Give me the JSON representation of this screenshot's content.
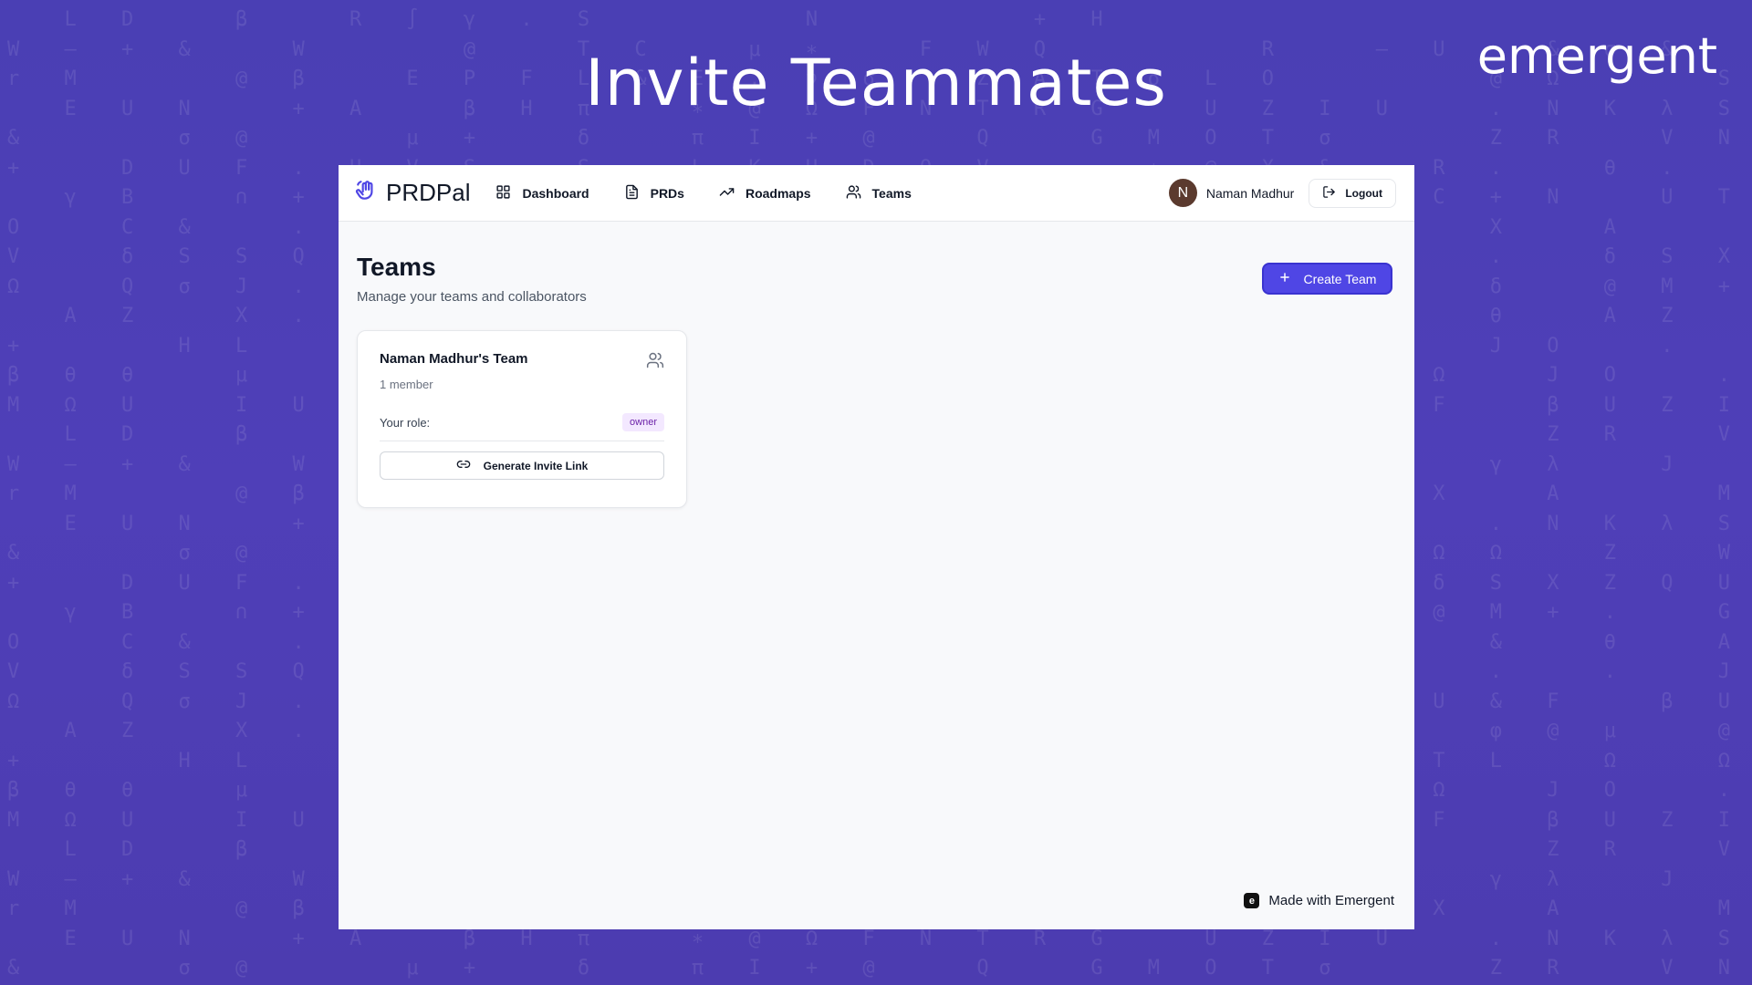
{
  "promo": {
    "title": "Invite Teammates",
    "brand": "emergent"
  },
  "app": {
    "name": "PRDPal",
    "nav": [
      {
        "label": "Dashboard",
        "icon": "grid-icon"
      },
      {
        "label": "PRDs",
        "icon": "document-icon"
      },
      {
        "label": "Roadmaps",
        "icon": "trending-up-icon"
      },
      {
        "label": "Teams",
        "icon": "users-icon"
      }
    ],
    "user": {
      "initial": "N",
      "name": "Naman Madhur"
    },
    "logout_label": "Logout"
  },
  "page": {
    "title": "Teams",
    "subtitle": "Manage your teams and collaborators",
    "create_label": "Create Team",
    "accent_color": "#4f46e5"
  },
  "team_card": {
    "name": "Naman Madhur's Team",
    "members": "1 member",
    "role_label": "Your role:",
    "role_value": "owner",
    "invite_label": "Generate Invite Link"
  },
  "footer": {
    "made_with": "Made with Emergent"
  }
}
